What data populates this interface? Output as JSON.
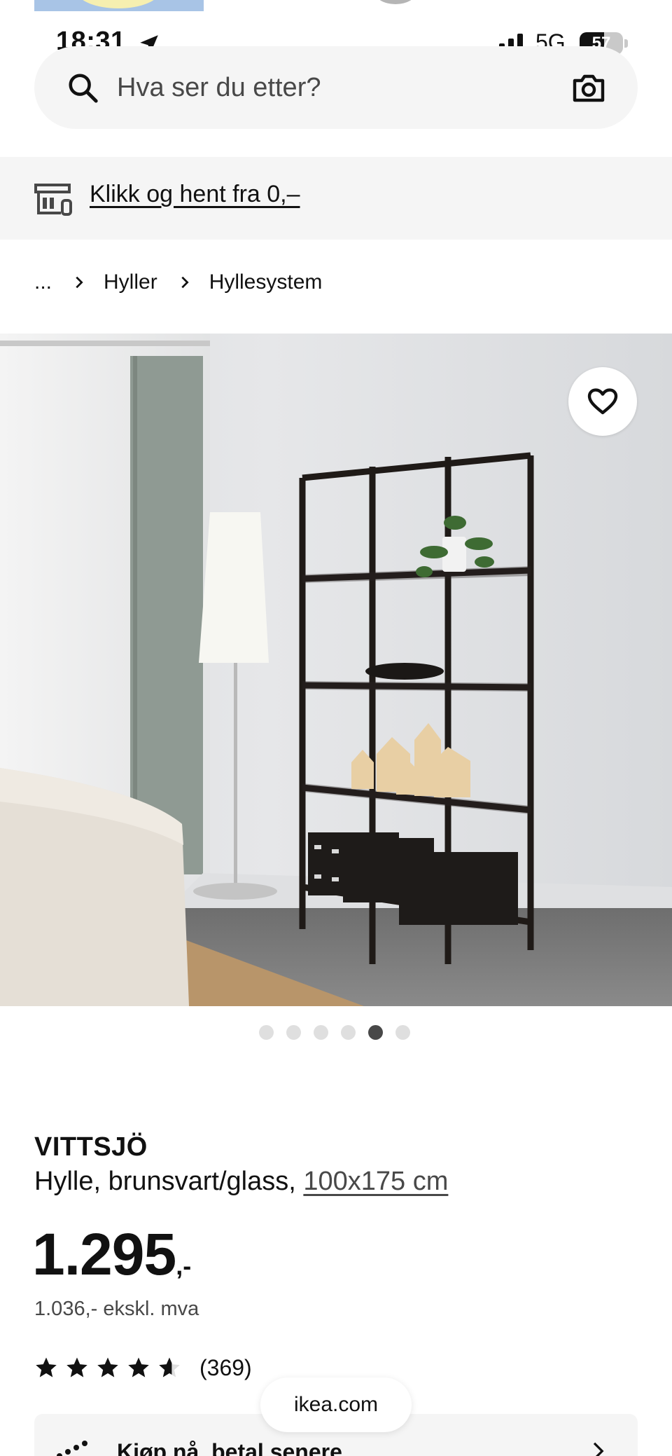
{
  "status_bar": {
    "time": "18:31",
    "network": "5G",
    "battery_level": "57",
    "battery_fraction": 0.57
  },
  "search": {
    "placeholder": "Hva ser du etter?"
  },
  "banner": {
    "link_text": "Klikk og hent fra 0,–"
  },
  "breadcrumb": {
    "ellipsis": "...",
    "items": [
      "Hyller",
      "Hyllesystem"
    ]
  },
  "carousel": {
    "total_images": 6,
    "active_index": 4
  },
  "product": {
    "name": "VITTSJÖ",
    "description": "Hylle, brunsvart/glass, ",
    "size": "100x175 cm",
    "price_main": "1.295",
    "price_suffix": ",-",
    "price_ex_vat": "1.036,- ekskl. mva",
    "rating_value": 4.6,
    "rating_count": "(369)"
  },
  "browser": {
    "domain": "ikea.com"
  },
  "klarna": {
    "label": "Kjøp nå, betal senere"
  },
  "colors": {
    "page_bg": "#ffffff",
    "panel_bg": "#f5f5f5",
    "text_primary": "#111111",
    "text_secondary": "#484848",
    "dot_active": "#484848",
    "dot_inactive": "#dfdfdf"
  }
}
